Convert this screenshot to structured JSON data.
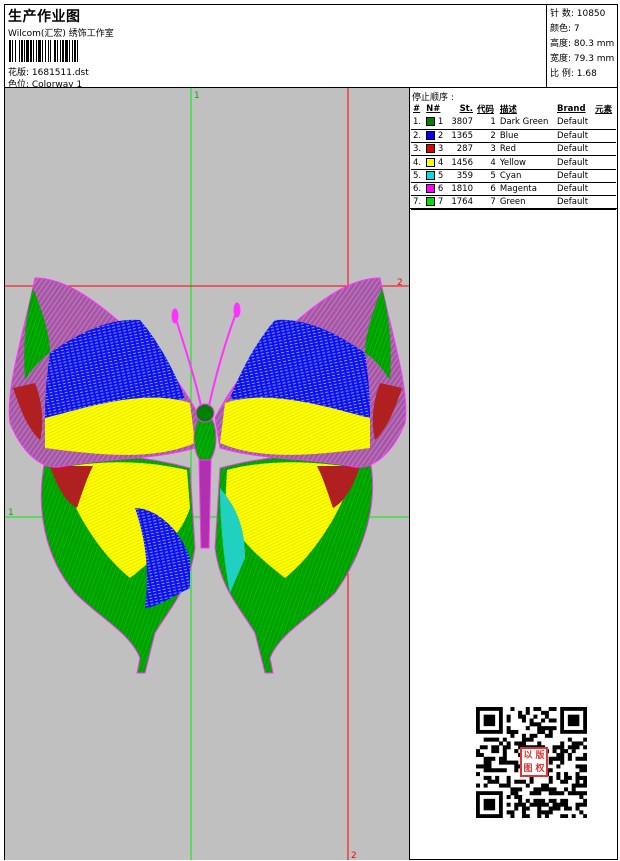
{
  "header": {
    "title": "生产作业图",
    "company": "Wilcom(汇宏) 绣饰工作室",
    "design_label": "花版: 1681511.dst",
    "colorway_label": "色位: Colorway 1"
  },
  "stats": {
    "stitches": "针 数: 10850",
    "colors": "颜色: 7",
    "height": "高度: 80.3 mm",
    "width": "宽度: 79.3 mm",
    "scale": "比 例: 1.68"
  },
  "guides": {
    "green_top": "1",
    "green_left": "1",
    "red_right": "2",
    "red_bottom": "2"
  },
  "sequence": {
    "title": "停止顺序 :",
    "headers": [
      "#",
      "N#",
      "St.",
      "代码",
      "描述",
      "Brand",
      "元素"
    ],
    "rows": [
      {
        "num": "1.",
        "n": "1",
        "st": "3807",
        "code": "1",
        "desc": "Dark Green",
        "brand": "Default",
        "color": "#008000"
      },
      {
        "num": "2.",
        "n": "2",
        "st": "1365",
        "code": "2",
        "desc": "Blue",
        "brand": "Default",
        "color": "#0000ff"
      },
      {
        "num": "3.",
        "n": "3",
        "st": "287",
        "code": "3",
        "desc": "Red",
        "brand": "Default",
        "color": "#e00000"
      },
      {
        "num": "4.",
        "n": "4",
        "st": "1456",
        "code": "4",
        "desc": "Yellow",
        "brand": "Default",
        "color": "#ffff00"
      },
      {
        "num": "5.",
        "n": "5",
        "st": "359",
        "code": "5",
        "desc": "Cyan",
        "brand": "Default",
        "color": "#00e0e0"
      },
      {
        "num": "6.",
        "n": "6",
        "st": "1810",
        "code": "6",
        "desc": "Magenta",
        "brand": "Default",
        "color": "#ff00ff"
      },
      {
        "num": "7.",
        "n": "7",
        "st": "1764",
        "code": "7",
        "desc": "Green",
        "brand": "Default",
        "color": "#00e000"
      }
    ]
  },
  "stamp": [
    "以",
    "图",
    "版",
    "权"
  ]
}
